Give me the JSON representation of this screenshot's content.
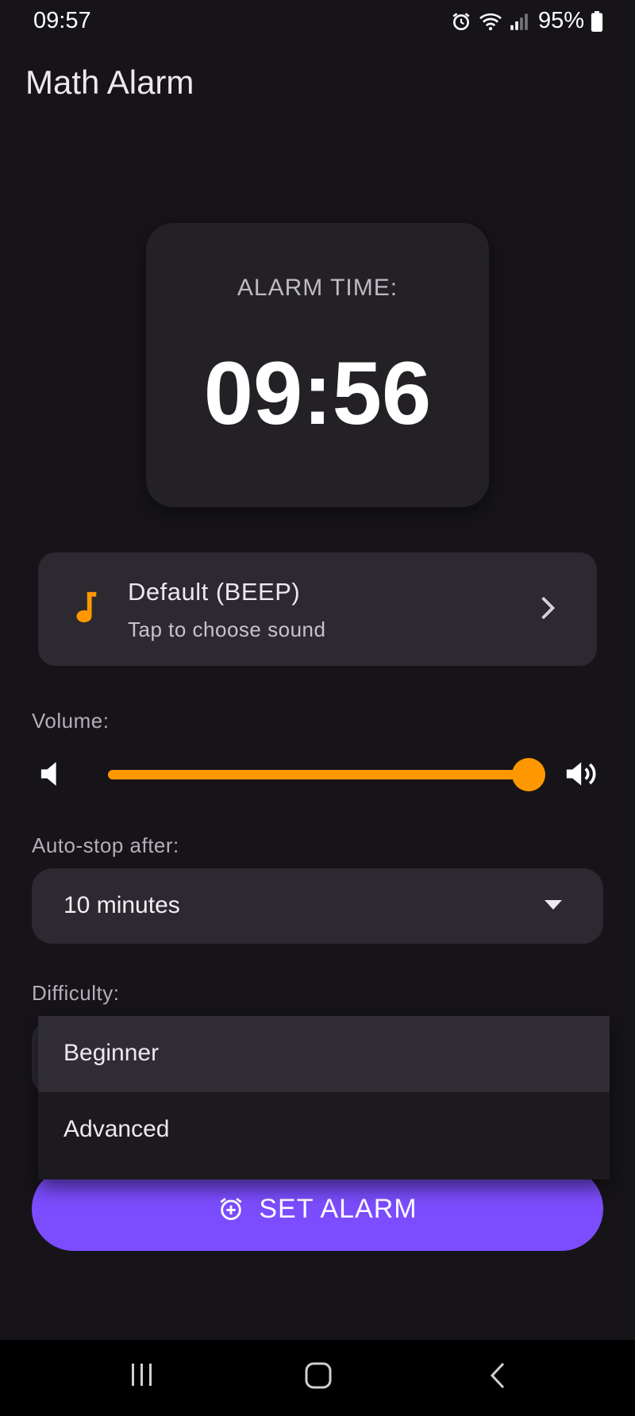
{
  "status_bar": {
    "time": "09:57",
    "battery": "95%"
  },
  "app": {
    "title": "Math Alarm"
  },
  "alarm": {
    "label": "ALARM TIME:",
    "time": "09:56"
  },
  "sound": {
    "title": "Default (BEEP)",
    "subtitle": "Tap to choose sound",
    "icon": "music-note-icon"
  },
  "volume": {
    "label": "Volume:",
    "level": 1.0
  },
  "auto_stop": {
    "label": "Auto-stop after:",
    "value": "10 minutes"
  },
  "difficulty": {
    "label": "Difficulty:",
    "options": [
      "Beginner",
      "Advanced"
    ],
    "highlighted": "Beginner"
  },
  "set_alarm": {
    "label": "SET ALARM"
  },
  "colors": {
    "accent": "#ff9800",
    "primary_button": "#7c4dff",
    "background": "#161419"
  }
}
